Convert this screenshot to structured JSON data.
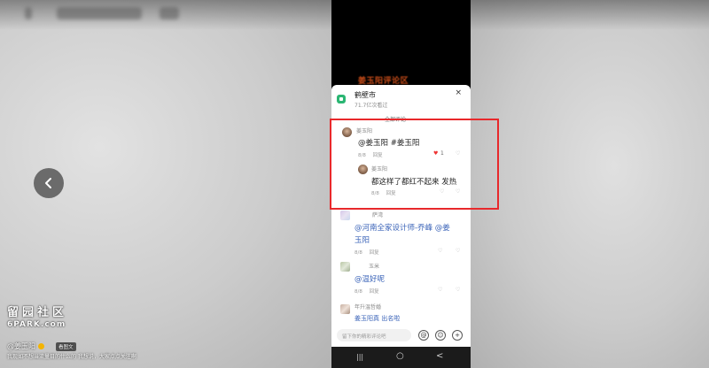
{
  "background": {
    "back_icon": "chevron-left-icon"
  },
  "phone": {
    "video_overlay_text": "姜玉阳评论区",
    "panel": {
      "title": "鹤壁市",
      "subtitle": "71.7亿次看过",
      "close_label": "×",
      "section_label": "全部评论"
    },
    "comments": [
      {
        "user": "姜玉阳",
        "text": "@姜玉阳 #姜玉阳",
        "time": "8/8",
        "reply_label": "回复",
        "likes": "1"
      },
      {
        "user": "姜玉阳",
        "text": "都这样了都红不起来 发热",
        "time": "8/8",
        "reply_label": "回复"
      },
      {
        "user": "萨湾",
        "text": "@河南全家设计师-乔峰 @姜",
        "text2": "玉阳",
        "time": "8/8",
        "reply_label": "回复"
      },
      {
        "user": "玉米",
        "text": "@温好呢",
        "time": "8/8",
        "reply_label": "回复"
      },
      {
        "user": "年升温哲婚",
        "text": "姜玉阳真 出名啦",
        "time": "",
        "reply_label": ""
      }
    ],
    "input": {
      "placeholder": "留下你的精彩评论吧",
      "at_label": "@",
      "emoji_label": "☺",
      "plus_label": "+"
    },
    "nav": {
      "menu_label": "|||",
      "home_label": "○",
      "back_label": "<"
    }
  },
  "overlay": {
    "watermark_cn": "留园社区",
    "watermark_en": "6PARK.com",
    "author": "@姜玉阳",
    "tag": "看图文",
    "caption": "我现如不想当流量日的什么的 我想说，大家点点关注啊"
  },
  "colors": {
    "highlight_border": "#e8282b",
    "like_red": "#e33333",
    "mention_blue": "#3a63b8"
  }
}
